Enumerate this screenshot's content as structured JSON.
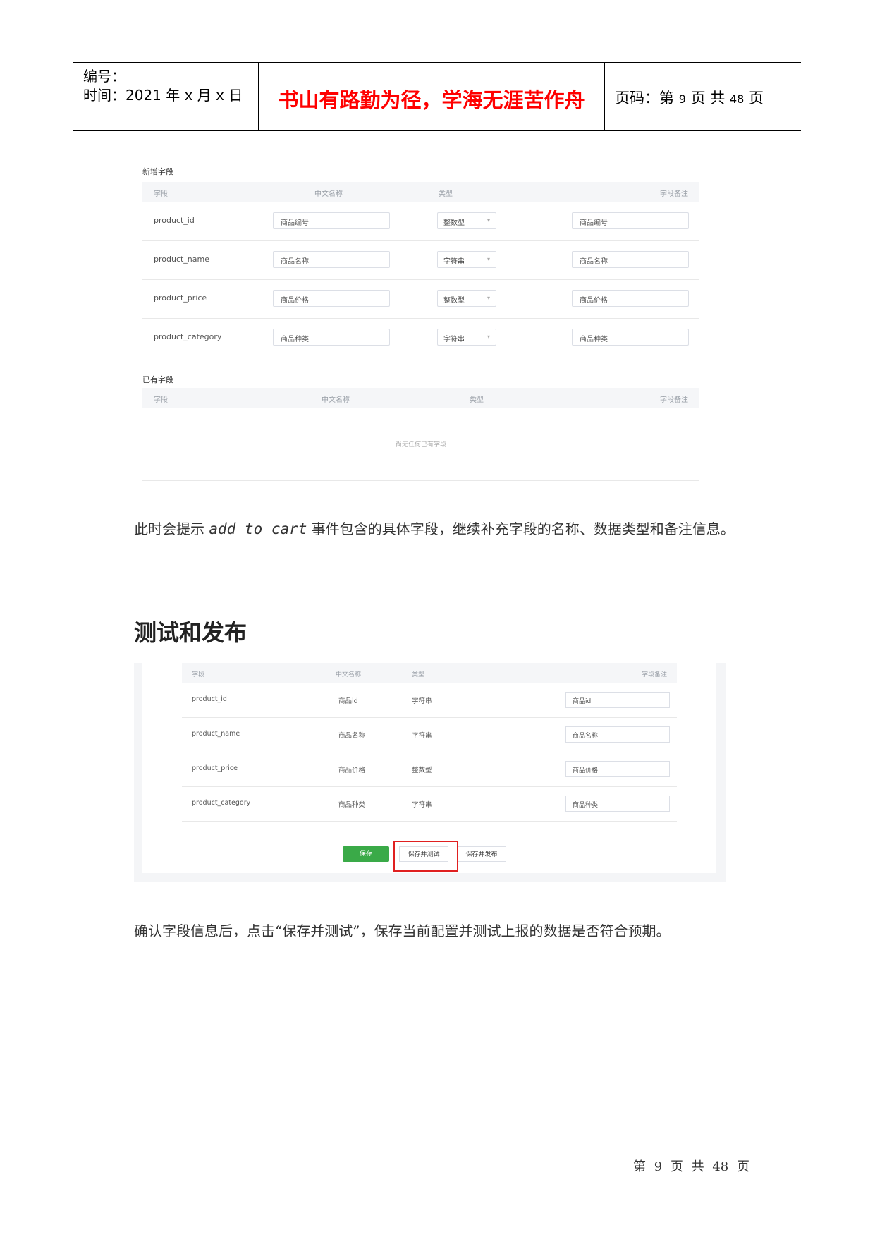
{
  "header": {
    "number_label": "编号：",
    "time_label": "时间：2021 年 x 月 x 日",
    "motto": "书山有路勤为径，学海无涯苦作舟",
    "page_prefix": "页码：第",
    "page_no": "9",
    "page_mid": "页  共",
    "page_total": "48",
    "page_suffix": "页"
  },
  "screenshot1": {
    "new_fields_title": "新增字段",
    "existing_fields_title": "已有字段",
    "columns": [
      "字段",
      "中文名称",
      "类型",
      "字段备注"
    ],
    "rows": [
      {
        "field": "product_id",
        "cn_name": "商品编号",
        "type": "整数型",
        "note": "商品编号"
      },
      {
        "field": "product_name",
        "cn_name": "商品名称",
        "type": "字符串",
        "note": "商品名称"
      },
      {
        "field": "product_price",
        "cn_name": "商品价格",
        "type": "整数型",
        "note": "商品价格"
      },
      {
        "field": "product_category",
        "cn_name": "商品种类",
        "type": "字符串",
        "note": "商品种类"
      }
    ],
    "empty_message": "尚无任何已有字段",
    "dropdown_icon": "chevron-down-icon"
  },
  "paragraph1": {
    "before": "此时会提示 ",
    "code": "add_to_cart",
    "after": " 事件包含的具体字段，继续补充字段的名称、数据类型和备注信息。"
  },
  "section_heading": "测试和发布",
  "screenshot2": {
    "columns": [
      "字段",
      "中文名称",
      "类型",
      "字段备注"
    ],
    "rows": [
      {
        "field": "product_id",
        "cn_name": "商品id",
        "type": "字符串",
        "note": "商品id"
      },
      {
        "field": "product_name",
        "cn_name": "商品名称",
        "type": "字符串",
        "note": "商品名称"
      },
      {
        "field": "product_price",
        "cn_name": "商品价格",
        "type": "整数型",
        "note": "商品价格"
      },
      {
        "field": "product_category",
        "cn_name": "商品种类",
        "type": "字符串",
        "note": "商品种类"
      }
    ],
    "save_label": "保存",
    "save_test_label": "保存并测试",
    "save_publish_label": "保存并发布",
    "save_color": "#3aaa48",
    "highlight_color": "#e02020"
  },
  "paragraph2": "确认字段信息后，点击“保存并测试”，保存当前配置并测试上报的数据是否符合预期。",
  "footer": "第 9 页 共 48 页"
}
